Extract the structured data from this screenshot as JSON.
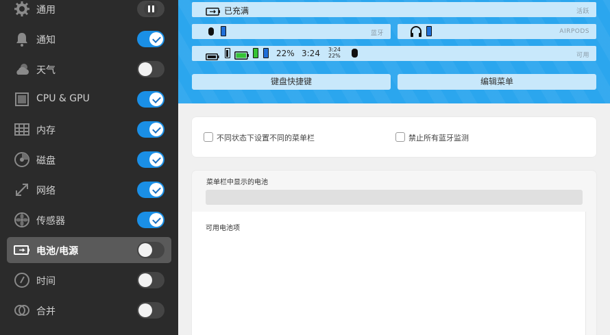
{
  "sidebar": {
    "items": [
      {
        "label": "通用",
        "icon": "gear-icon",
        "control": "pause"
      },
      {
        "label": "通知",
        "icon": "bell-icon",
        "control": "on"
      },
      {
        "label": "天气",
        "icon": "cloud-sun-icon",
        "control": "off"
      },
      {
        "label": "CPU & GPU",
        "icon": "chip-icon",
        "control": "on"
      },
      {
        "label": "内存",
        "icon": "memory-icon",
        "control": "on"
      },
      {
        "label": "磁盘",
        "icon": "disk-icon",
        "control": "on"
      },
      {
        "label": "网络",
        "icon": "network-arrows-icon",
        "control": "on"
      },
      {
        "label": "传感器",
        "icon": "fan-icon",
        "control": "on"
      },
      {
        "label": "电池/电源",
        "icon": "battery-icon",
        "control": "off",
        "active": true
      },
      {
        "label": "时间",
        "icon": "clock-icon",
        "control": "off"
      },
      {
        "label": "合并",
        "icon": "merge-circles-icon",
        "control": "off"
      }
    ]
  },
  "preview": {
    "row1": {
      "status": "已充满",
      "tag": "活跃"
    },
    "row2": {
      "left_tag": "蓝牙",
      "right_tag": "AIRPODS"
    },
    "row3": {
      "percent": "22%",
      "time": "3:24",
      "small_time": "3:24",
      "small_percent": "22%",
      "tag": "可用"
    },
    "buttons": {
      "keyboard_shortcuts": "键盘快捷键",
      "edit_menu": "编辑菜单"
    }
  },
  "options": {
    "different_menubar": "不同状态下设置不同的菜单栏",
    "disable_bluetooth": "禁止所有蓝牙监测"
  },
  "battery_section": {
    "menubar_title": "菜单栏中显示的电池",
    "available_title": "可用电池项"
  },
  "colors": {
    "sidebar_bg": "#2b2b2b",
    "accent": "#1a8fe6",
    "header_blue": "#2ba6ee"
  }
}
